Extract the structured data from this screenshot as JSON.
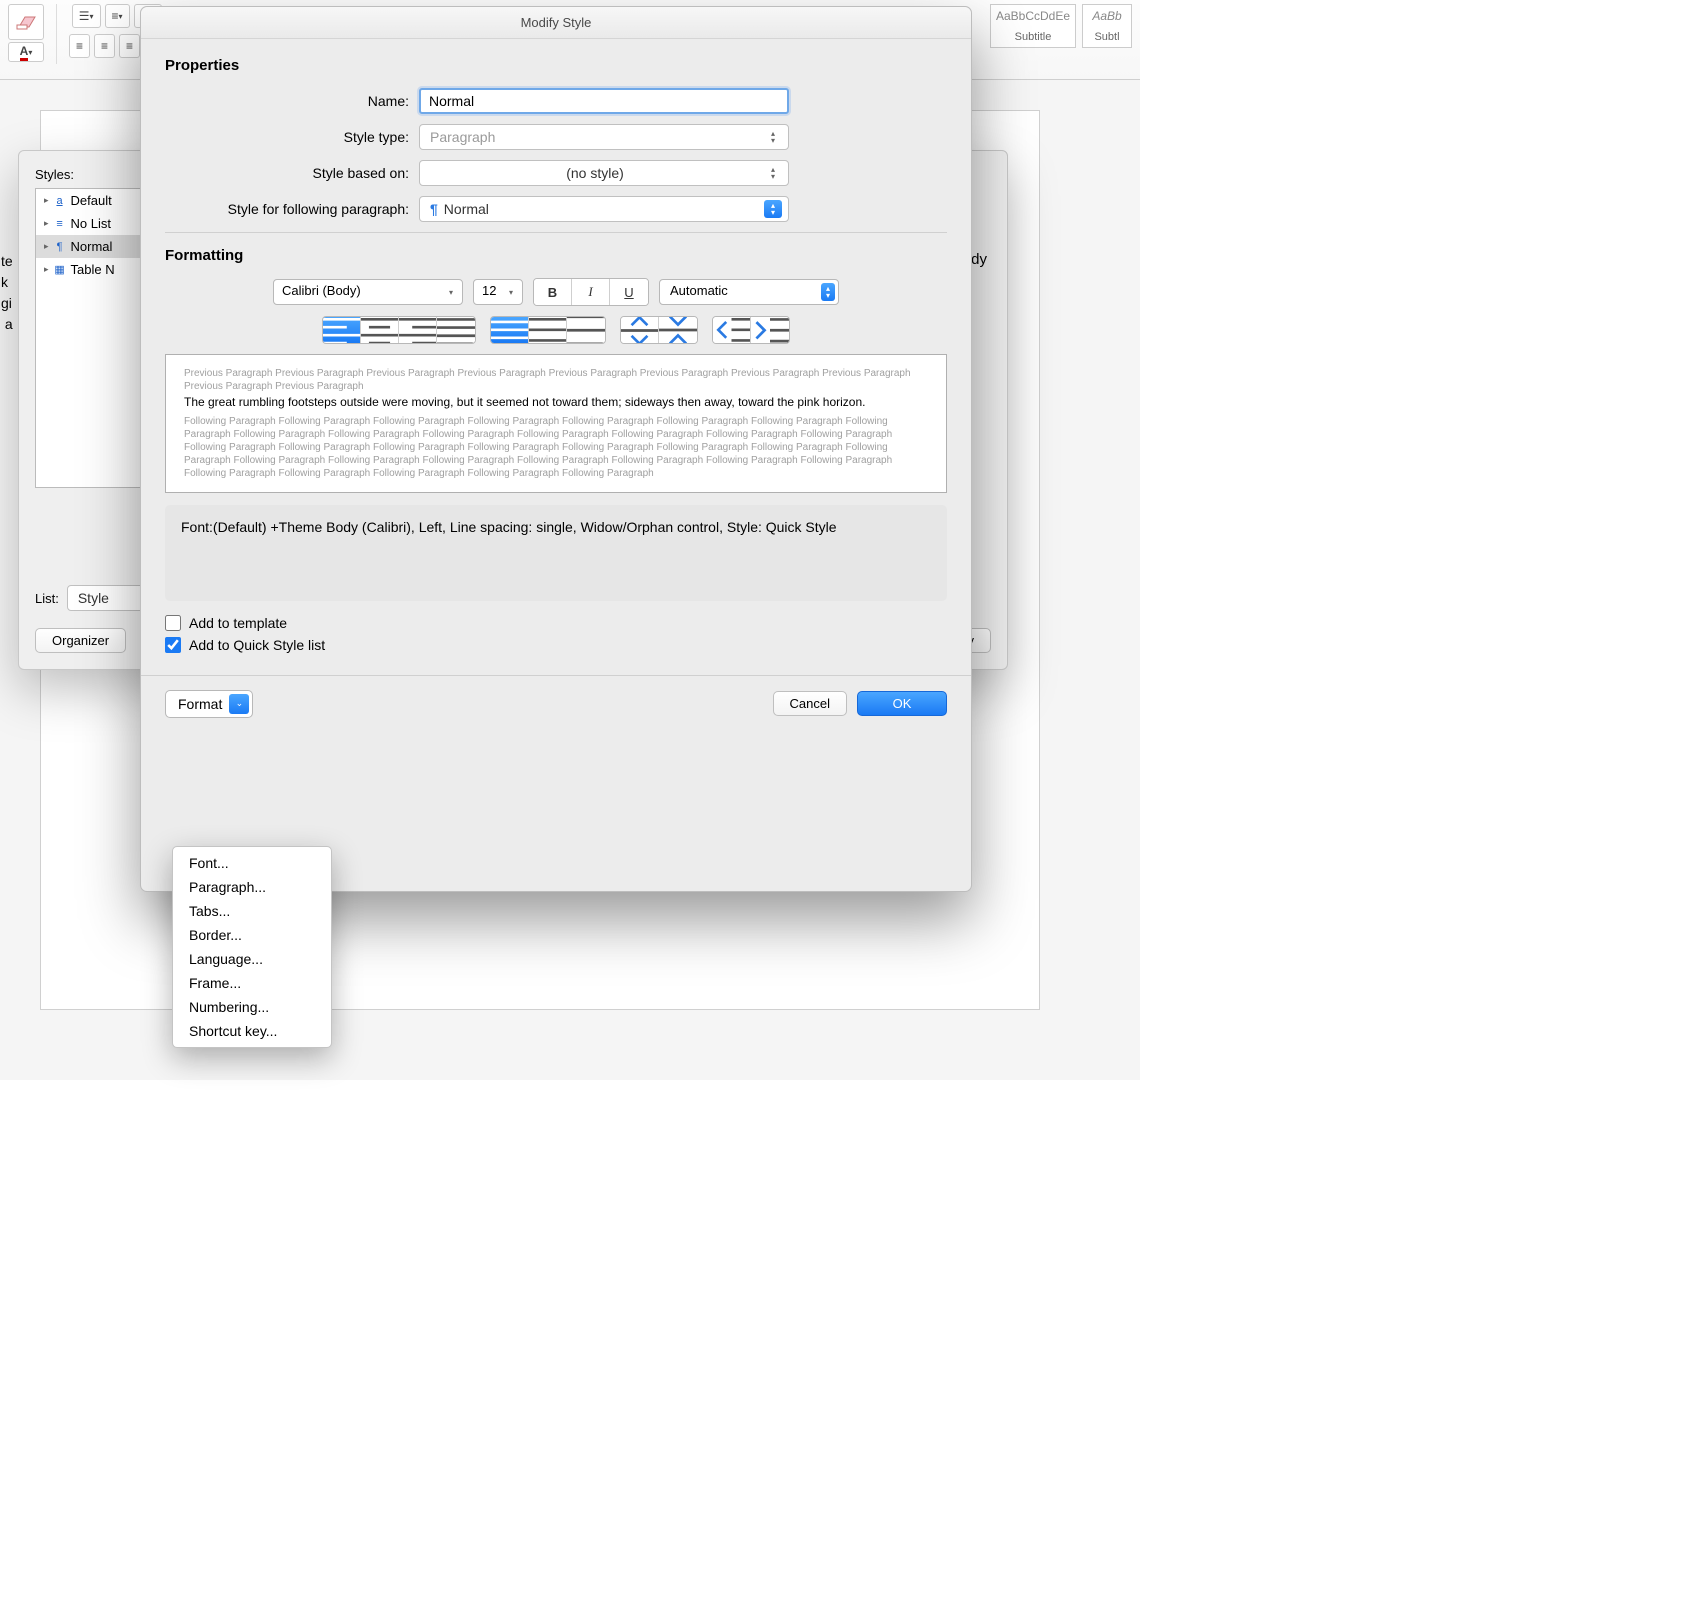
{
  "ribbon": {
    "style_subtitle": {
      "sample": "AaBbCcDdEe",
      "name": "Subtitle"
    },
    "style_subtle": {
      "sample": "AaBb",
      "name": "Subtl"
    }
  },
  "styles_pane": {
    "heading": "Styles:",
    "items": [
      {
        "icon": "a",
        "color": "#1e62c9",
        "label": "Default "
      },
      {
        "icon": "≡",
        "color": "#1e62c9",
        "label": "No List"
      },
      {
        "icon": "¶",
        "color": "#1e62c9",
        "label": "Normal"
      },
      {
        "icon": "▦",
        "color": "#1e62c9",
        "label": "Table N"
      }
    ],
    "selected_index": 2,
    "list_label": "List:",
    "list_value": "Style",
    "organizer_btn": "Organizer",
    "apply_btn": "Apply",
    "body_hint": "e Body"
  },
  "doc_fragment": "te\nk\ngi\n a",
  "dialog": {
    "title": "Modify Style",
    "sections": {
      "properties": "Properties",
      "formatting": "Formatting"
    },
    "props": {
      "name_label": "Name:",
      "name_value": "Normal",
      "type_label": "Style type:",
      "type_value": "Paragraph",
      "based_label": "Style based on:",
      "based_value": "(no style)",
      "follow_label": "Style for following paragraph:",
      "follow_value": "Normal"
    },
    "formatting_bar": {
      "font": "Calibri (Body)",
      "size": "12",
      "color": "Automatic"
    },
    "preview": {
      "prev": "Previous Paragraph Previous Paragraph Previous Paragraph Previous Paragraph Previous Paragraph Previous Paragraph Previous Paragraph Previous Paragraph Previous Paragraph Previous Paragraph",
      "sample": "The great rumbling footsteps outside were moving, but it seemed not toward them; sideways then away, toward the pink horizon.",
      "next": "Following Paragraph Following Paragraph Following Paragraph Following Paragraph Following Paragraph Following Paragraph Following Paragraph Following Paragraph Following Paragraph Following Paragraph Following Paragraph Following Paragraph Following Paragraph Following Paragraph Following Paragraph Following Paragraph Following Paragraph Following Paragraph Following Paragraph Following Paragraph Following Paragraph Following Paragraph Following Paragraph Following Paragraph Following Paragraph Following Paragraph Following Paragraph Following Paragraph Following Paragraph Following Paragraph Following Paragraph Following Paragraph Following Paragraph Following Paragraph Following Paragraph"
    },
    "description": "Font:(Default) +Theme Body (Calibri), Left, Line spacing:  single, Widow/Orphan control, Style: Quick Style",
    "add_template": "Add to template",
    "add_quick": "Add to Quick Style list",
    "format_btn": "Format",
    "cancel": "Cancel",
    "ok": "OK",
    "format_menu": [
      "Font...",
      "Paragraph...",
      "Tabs...",
      "Border...",
      "Language...",
      "Frame...",
      "Numbering...",
      "Shortcut key..."
    ]
  }
}
